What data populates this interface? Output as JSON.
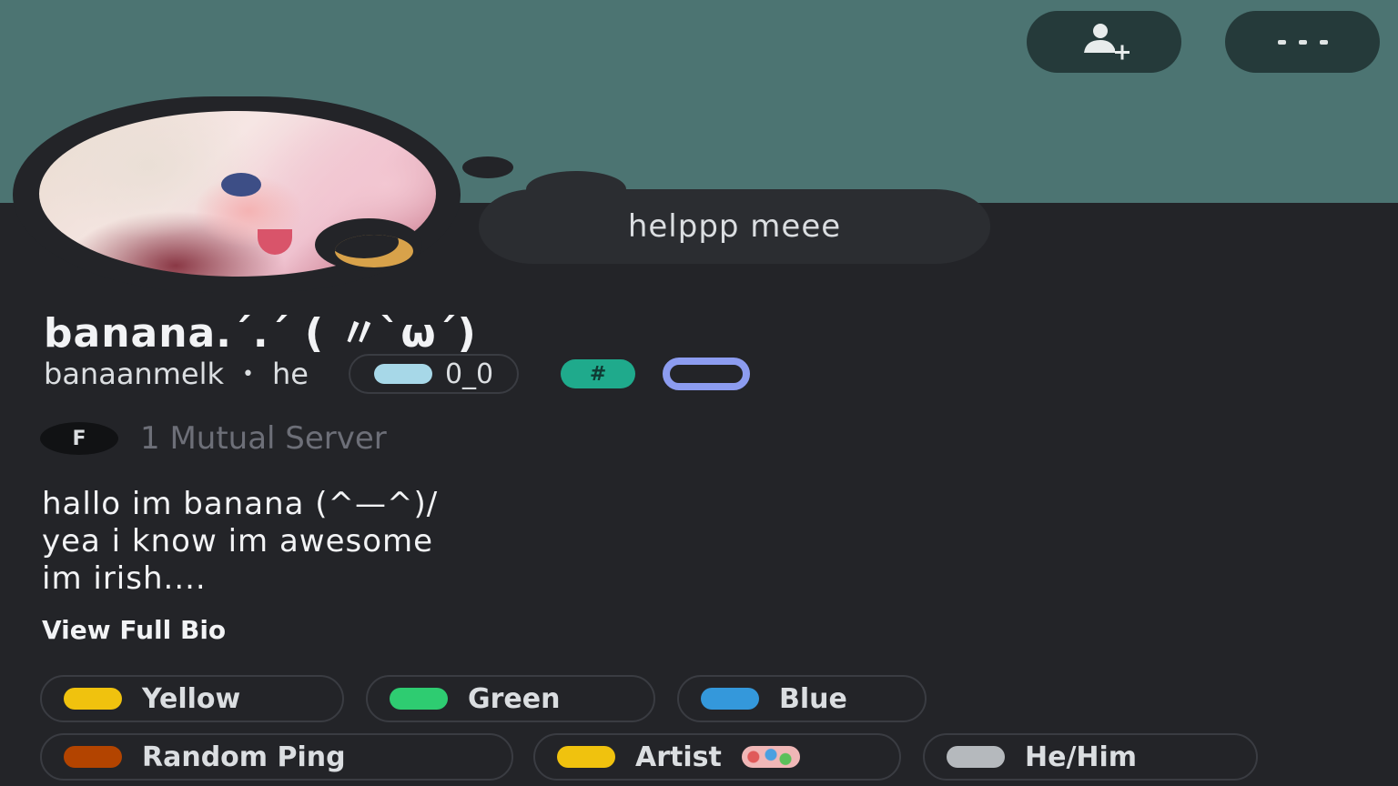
{
  "profile": {
    "custom_status": "helppp meee",
    "display_name": "banana.´.´ ( 〃`ω´)",
    "username": "banaanmelk",
    "separator": "•",
    "pronouns": "he",
    "tag_text": "0_0",
    "hash_badge": "#",
    "mutual_servers": "1 Mutual Server",
    "server_icon_text": "F",
    "bio": "hallo im banana (^—^)/\nyea i know im awesome\nim irish....",
    "view_full_bio": "View Full Bio"
  },
  "banner": {
    "color": "#4c7472",
    "add_friend_icon": "add-friend-icon",
    "more_icon": "more-icon"
  },
  "status": {
    "type": "idle",
    "icon": "moon-icon",
    "color": "#d8a24a"
  },
  "roles": [
    {
      "label": "Yellow",
      "color": "#f0c20e"
    },
    {
      "label": "Green",
      "color": "#2ecc71"
    },
    {
      "label": "Blue",
      "color": "#3498db"
    },
    {
      "label": "Random Ping",
      "color": "#b34400"
    },
    {
      "label": "Artist",
      "color": "#f0c20e",
      "emoji": "palette-icon"
    },
    {
      "label": "He/Him",
      "color": "#b5b9bd"
    }
  ]
}
